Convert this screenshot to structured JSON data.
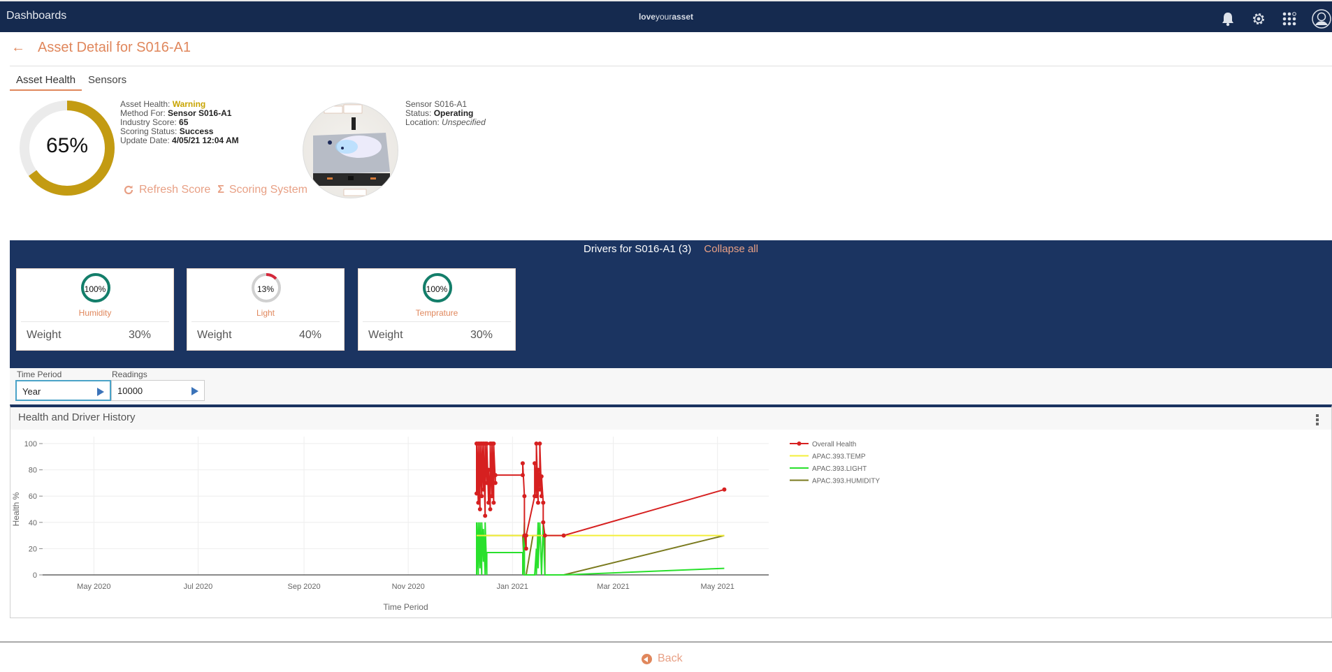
{
  "topbar": {
    "brand": "Dashboards",
    "logo_light1": "love",
    "logo_regular": "your",
    "logo_light2": "asset",
    "icons": [
      "bell-icon",
      "gear-icon",
      "app-grid-icon",
      "user-avatar-icon"
    ]
  },
  "header": {
    "back_icon": "arrow-left-icon",
    "title": "Asset Detail for S016-A1"
  },
  "tabs": [
    {
      "label": "Asset Health",
      "active": true
    },
    {
      "label": "Sensors",
      "active": false
    }
  ],
  "health": {
    "score_percent": 65,
    "score_label": "65%",
    "gauge_color": "#c39b12",
    "fields": [
      {
        "label": "Asset Health: ",
        "value": "Warning"
      },
      {
        "label": "Method For: ",
        "value": "Sensor S016-A1"
      },
      {
        "label": "Industry Score: ",
        "value": "65"
      },
      {
        "label": "Scoring Status: ",
        "value": "Success"
      },
      {
        "label": "Update Date: ",
        "value": "4/05/21 12:04 AM"
      }
    ],
    "actions": [
      {
        "label": "Refresh Score",
        "icon": "refresh-icon"
      },
      {
        "label": "Scoring System",
        "icon": "sigma-icon"
      }
    ]
  },
  "sensor": {
    "name": "Sensor S016-A1",
    "status_label": "Status: ",
    "status_value": "Operating",
    "location_label": "Location: ",
    "location_value": "Unspecified"
  },
  "drivers": {
    "title": "Drivers for S016-A1 (3)",
    "collapse_label": "Collapse all",
    "cards": [
      {
        "name": "Humidity",
        "score": 100,
        "score_label": "100%",
        "weight_label": "Weight",
        "weight": "30%",
        "color": "#137e6a"
      },
      {
        "name": "Light",
        "score": 13,
        "score_label": "13%",
        "weight_label": "Weight",
        "weight": "40%",
        "color": "#d4283a"
      },
      {
        "name": "Temprature",
        "score": 100,
        "score_label": "100%",
        "weight_label": "Weight",
        "weight": "30%",
        "color": "#137e6a"
      }
    ]
  },
  "filters": {
    "time_period_label": "Time Period",
    "time_period_value": "Year",
    "readings_label": "Readings",
    "readings_value": "10000"
  },
  "chart_panel": {
    "title": "Health and Driver History",
    "menu_icon": "kebab-menu-icon"
  },
  "chart_data": {
    "type": "line",
    "title": "Health and Driver History",
    "xlabel": "Time Period",
    "ylabel": "Health %",
    "ylim": [
      0,
      100
    ],
    "yticks": [
      0,
      20,
      40,
      60,
      80,
      100
    ],
    "xlim": [
      "2020-04-01",
      "2021-05-31"
    ],
    "xticks": [
      {
        "date": "2020-05-01",
        "label": "May 2020"
      },
      {
        "date": "2020-07-01",
        "label": "Jul 2020"
      },
      {
        "date": "2020-09-01",
        "label": "Sep 2020"
      },
      {
        "date": "2020-11-01",
        "label": "Nov 2020"
      },
      {
        "date": "2021-01-01",
        "label": "Jan 2021"
      },
      {
        "date": "2021-03-01",
        "label": "Mar 2021"
      },
      {
        "date": "2021-05-01",
        "label": "May 2021"
      }
    ],
    "grid": true,
    "legend": "right",
    "series": [
      {
        "name": "Overall Health",
        "color": "#d62020",
        "markers": true,
        "points": [
          [
            "2020-12-11",
            62
          ],
          [
            "2020-12-11",
            100
          ],
          [
            "2020-12-12",
            55
          ],
          [
            "2020-12-12",
            100
          ],
          [
            "2020-12-13",
            50
          ],
          [
            "2020-12-13",
            100
          ],
          [
            "2020-12-14",
            60
          ],
          [
            "2020-12-14",
            100
          ],
          [
            "2020-12-15",
            65
          ],
          [
            "2020-12-15",
            100
          ],
          [
            "2020-12-16",
            45
          ],
          [
            "2020-12-16",
            100
          ],
          [
            "2020-12-17",
            70
          ],
          [
            "2020-12-17",
            100
          ],
          [
            "2020-12-18",
            55
          ],
          [
            "2020-12-18",
            80
          ],
          [
            "2020-12-19",
            50
          ],
          [
            "2020-12-19",
            100
          ],
          [
            "2020-12-20",
            60
          ],
          [
            "2020-12-20",
            100
          ],
          [
            "2020-12-21",
            55
          ],
          [
            "2020-12-21",
            100
          ],
          [
            "2020-12-22",
            70
          ],
          [
            "2020-12-22",
            76
          ],
          [
            "2021-01-07",
            76
          ],
          [
            "2021-01-07",
            85
          ],
          [
            "2021-01-08",
            60
          ],
          [
            "2021-01-08",
            30
          ],
          [
            "2021-01-09",
            20
          ],
          [
            "2021-01-09",
            30
          ],
          [
            "2021-01-14",
            60
          ],
          [
            "2021-01-14",
            85
          ],
          [
            "2021-01-15",
            60
          ],
          [
            "2021-01-15",
            100
          ],
          [
            "2021-01-16",
            55
          ],
          [
            "2021-01-16",
            80
          ],
          [
            "2021-01-17",
            65
          ],
          [
            "2021-01-17",
            100
          ],
          [
            "2021-01-18",
            60
          ],
          [
            "2021-01-18",
            75
          ],
          [
            "2021-01-19",
            55
          ],
          [
            "2021-01-19",
            40
          ],
          [
            "2021-01-20",
            30
          ],
          [
            "2021-01-31",
            30
          ],
          [
            "2021-05-05",
            65
          ]
        ]
      },
      {
        "name": "APAC.393.TEMP",
        "color": "#f3ef3a",
        "markers": false,
        "points": [
          [
            "2020-12-11",
            30
          ],
          [
            "2021-05-05",
            30
          ]
        ]
      },
      {
        "name": "APAC.393.LIGHT",
        "color": "#29e02c",
        "markers": false,
        "points": [
          [
            "2020-12-11",
            0
          ],
          [
            "2020-12-11",
            40
          ],
          [
            "2020-12-12",
            0
          ],
          [
            "2020-12-12",
            40
          ],
          [
            "2020-12-13",
            5
          ],
          [
            "2020-12-13",
            40
          ],
          [
            "2020-12-14",
            0
          ],
          [
            "2020-12-14",
            40
          ],
          [
            "2020-12-15",
            10
          ],
          [
            "2020-12-15",
            35
          ],
          [
            "2020-12-16",
            0
          ],
          [
            "2020-12-16",
            40
          ],
          [
            "2020-12-17",
            0
          ],
          [
            "2020-12-17",
            17
          ],
          [
            "2021-01-07",
            17
          ],
          [
            "2021-01-07",
            0
          ],
          [
            "2021-01-08",
            40
          ],
          [
            "2021-01-08",
            0
          ],
          [
            "2021-01-09",
            0
          ],
          [
            "2021-01-14",
            0
          ],
          [
            "2021-01-15",
            20
          ],
          [
            "2021-01-15",
            0
          ],
          [
            "2021-01-16",
            40
          ],
          [
            "2021-01-16",
            5
          ],
          [
            "2021-01-17",
            40
          ],
          [
            "2021-01-18",
            0
          ],
          [
            "2021-01-19",
            40
          ],
          [
            "2021-01-20",
            0
          ],
          [
            "2021-01-31",
            0
          ],
          [
            "2021-05-05",
            5
          ]
        ]
      },
      {
        "name": "APAC.393.HUMIDITY",
        "color": "#7a7a1e",
        "markers": false,
        "points": [
          [
            "2020-12-11",
            30
          ],
          [
            "2021-01-07",
            30
          ],
          [
            "2021-01-08",
            0
          ],
          [
            "2021-01-09",
            0
          ],
          [
            "2021-01-13",
            30
          ],
          [
            "2021-01-20",
            30
          ],
          [
            "2021-01-20",
            0
          ],
          [
            "2021-01-31",
            0
          ],
          [
            "2021-05-05",
            30
          ]
        ]
      }
    ]
  },
  "footer": {
    "back_label": "Back",
    "back_icon": "arrow-left-circle-icon"
  }
}
